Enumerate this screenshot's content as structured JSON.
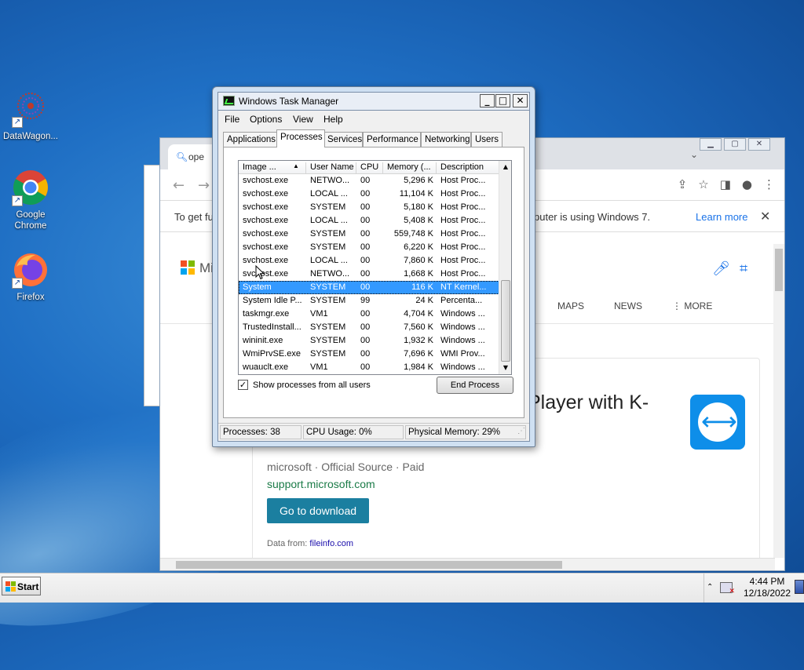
{
  "desktop": {
    "icons": [
      {
        "label": "DataWagon..."
      },
      {
        "label": "Google Chrome"
      },
      {
        "label": "Firefox"
      }
    ]
  },
  "browser": {
    "tab_text": "ope",
    "infobar_left": "To get fu",
    "infobar_message": "puter is using Windows 7.",
    "infobar_link": "Learn more",
    "bing_text": "Mi",
    "nav_links": [
      "MAPS",
      "NEWS",
      "⋮ MORE"
    ],
    "result_title": "Player with K-",
    "result_source": "microsoft · Official Source · Paid",
    "result_url": "support.microsoft.com",
    "result_button": "Go to download",
    "data_from_label": "Data from: ",
    "data_from_link": "fileinfo.com"
  },
  "taskmanager": {
    "title": "Windows Task Manager",
    "menu": [
      "File",
      "Options",
      "View",
      "Help"
    ],
    "tabs": [
      "Applications",
      "Processes",
      "Services",
      "Performance",
      "Networking",
      "Users"
    ],
    "active_tab": "Processes",
    "columns": [
      "Image ...",
      "User Name",
      "CPU",
      "Memory (...",
      "Description"
    ],
    "rows": [
      [
        "svchost.exe",
        "NETWO...",
        "00",
        "5,296 K",
        "Host Proc..."
      ],
      [
        "svchost.exe",
        "LOCAL ...",
        "00",
        "11,104 K",
        "Host Proc..."
      ],
      [
        "svchost.exe",
        "SYSTEM",
        "00",
        "5,180 K",
        "Host Proc..."
      ],
      [
        "svchost.exe",
        "LOCAL ...",
        "00",
        "5,408 K",
        "Host Proc..."
      ],
      [
        "svchost.exe",
        "SYSTEM",
        "00",
        "559,748 K",
        "Host Proc..."
      ],
      [
        "svchost.exe",
        "SYSTEM",
        "00",
        "6,220 K",
        "Host Proc..."
      ],
      [
        "svchost.exe",
        "LOCAL ...",
        "00",
        "7,860 K",
        "Host Proc..."
      ],
      [
        "svchost.exe",
        "NETWO...",
        "00",
        "1,668 K",
        "Host Proc..."
      ],
      [
        "System",
        "SYSTEM",
        "00",
        "116 K",
        "NT Kernel..."
      ],
      [
        "System Idle P...",
        "SYSTEM",
        "99",
        "24 K",
        "Percenta..."
      ],
      [
        "taskmgr.exe",
        "VM1",
        "00",
        "4,704 K",
        "Windows ..."
      ],
      [
        "TrustedInstall...",
        "SYSTEM",
        "00",
        "7,560 K",
        "Windows ..."
      ],
      [
        "wininit.exe",
        "SYSTEM",
        "00",
        "1,932 K",
        "Windows ..."
      ],
      [
        "WmiPrvSE.exe",
        "SYSTEM",
        "00",
        "7,696 K",
        "WMI Prov..."
      ],
      [
        "wuauclt.exe",
        "VM1",
        "00",
        "1,984 K",
        "Windows ..."
      ]
    ],
    "selected_row": 8,
    "show_all_label": "Show processes from all users",
    "show_all_checked": true,
    "end_process_label": "End Process",
    "status": {
      "processes": "Processes: 38",
      "cpu": "CPU Usage: 0%",
      "memory": "Physical Memory: 29%"
    }
  },
  "taskbar": {
    "start_label": "Start",
    "time": "4:44 PM",
    "date": "12/18/2022"
  }
}
